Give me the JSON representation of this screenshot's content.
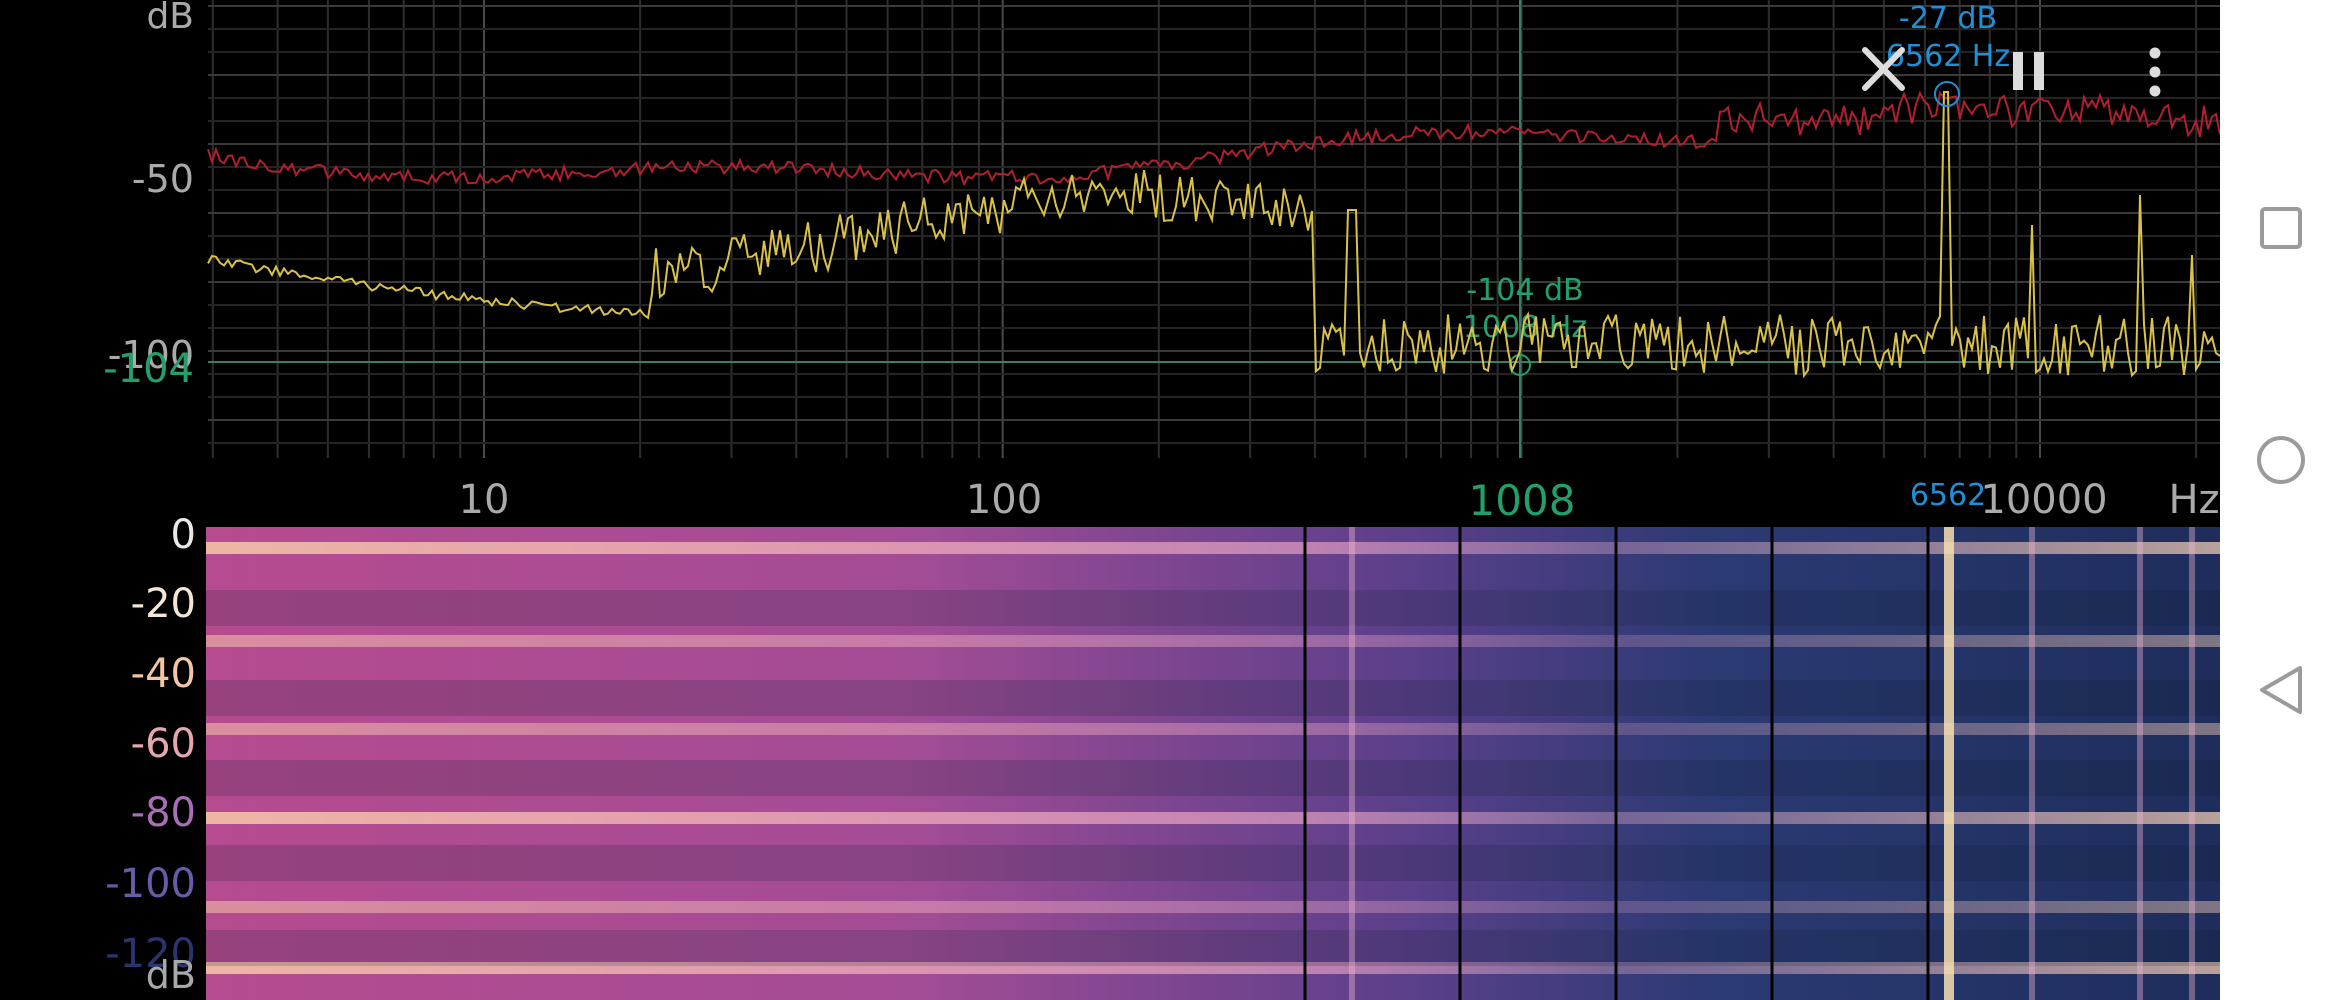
{
  "toolbar": {
    "close_icon": "close-icon",
    "pause_icon": "pause-icon",
    "menu_icon": "more-vert-icon"
  },
  "spectrum": {
    "ylabel_top": "dB",
    "yticks": [
      "-50",
      "-100"
    ],
    "xticks": [
      "10",
      "100",
      "1008",
      "10000",
      "Hz"
    ],
    "xlabel_unit": "Hz",
    "cursor": {
      "label": "-104",
      "db": "-104 dB",
      "freq": "1008 Hz",
      "marker_color": "#22a06b"
    },
    "peak": {
      "db": "-27 dB",
      "freq": "6562 Hz",
      "xtick": "6562",
      "color": "#1f8fd6"
    },
    "colors": {
      "red_trace": "#b21f2e",
      "yellow_trace": "#d9c24a",
      "grid": "#3a3a3a"
    }
  },
  "spectrogram": {
    "yticks": [
      "0",
      "-20",
      "-40",
      "-60",
      "-80",
      "-100",
      "-120"
    ],
    "ylabel_bottom": "dB",
    "colors": [
      "#f9d9b0",
      "#e59ac2",
      "#b15aa7",
      "#7a4aa3",
      "#3f3a7a",
      "#22305a",
      "#0d1f2a"
    ]
  },
  "navbar": {
    "recents_icon": "recents-icon",
    "home_icon": "home-icon",
    "back_icon": "back-icon"
  }
}
